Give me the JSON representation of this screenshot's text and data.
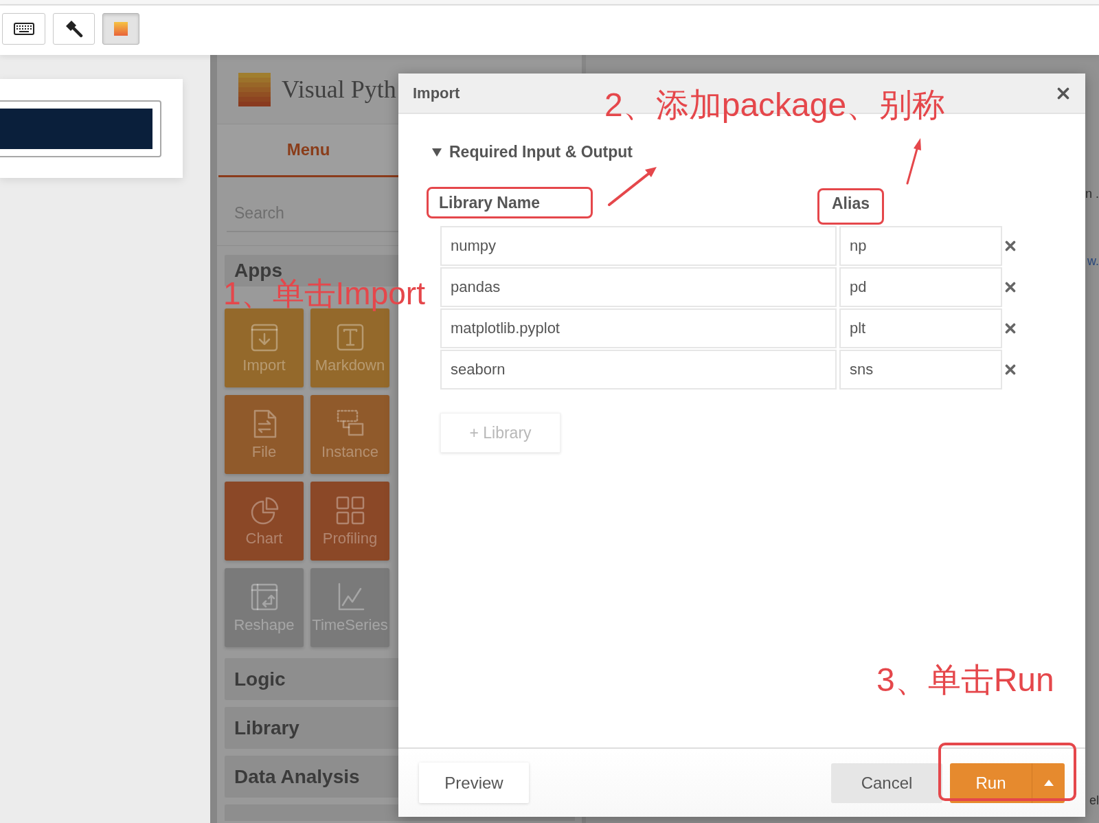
{
  "toolbar": {
    "buttons": [
      {
        "kind": "keyboard",
        "selected": false
      },
      {
        "kind": "hammer",
        "selected": false
      },
      {
        "kind": "swatch",
        "selected": true
      }
    ]
  },
  "panel": {
    "title": "Visual Pyth",
    "tabs": [
      {
        "label": "Menu",
        "selected": true
      }
    ],
    "search": {
      "placeholder": "Search"
    },
    "sections": [
      {
        "label": "Apps",
        "tiles": [
          {
            "kind": "import",
            "label": "Import",
            "color": "#94692b"
          },
          {
            "kind": "markdown",
            "label": "Markdown",
            "color": "#94692b"
          },
          {
            "kind": "file",
            "label": "File",
            "color": "#905a2b"
          },
          {
            "kind": "instance",
            "label": "Instance",
            "color": "#905a2b"
          },
          {
            "kind": "chart",
            "label": "Chart",
            "color": "#8b4827"
          },
          {
            "kind": "profiling",
            "label": "Profiling",
            "color": "#8b4827"
          },
          {
            "kind": "reshape",
            "label": "Reshape",
            "color": "#7a7a7a"
          },
          {
            "kind": "timeseries",
            "label": "TimeSeries",
            "color": "#7a7a7a"
          }
        ]
      },
      {
        "label": "Logic"
      },
      {
        "label": "Library"
      },
      {
        "label": "Data Analysis"
      }
    ]
  },
  "background_fragments": [
    {
      "kind": "text",
      "text": "n ."
    },
    {
      "kind": "link",
      "text": "w."
    },
    {
      "kind": "text",
      "text": "el"
    }
  ],
  "dialog": {
    "title": "Import",
    "section": {
      "title": "Required Input & Output",
      "expanded": true
    },
    "columns": [
      {
        "label": "Library Name",
        "highlighted": true
      },
      {
        "label": "Alias",
        "highlighted": true
      }
    ],
    "rows": [
      {
        "library": "numpy",
        "alias": "np"
      },
      {
        "library": "pandas",
        "alias": "pd"
      },
      {
        "library": "matplotlib.pyplot",
        "alias": "plt"
      },
      {
        "library": "seaborn",
        "alias": "sns"
      }
    ],
    "add_button": "+ Library",
    "footer": {
      "preview": "Preview",
      "cancel": "Cancel",
      "run": {
        "label": "Run",
        "highlighted": true
      }
    }
  },
  "annotations": [
    {
      "kind": "plain",
      "text": "1、单击Import"
    },
    {
      "kind": "pointer",
      "text": "2、添加package、别称"
    },
    {
      "kind": "plain",
      "text": "3、单击Run"
    }
  ]
}
